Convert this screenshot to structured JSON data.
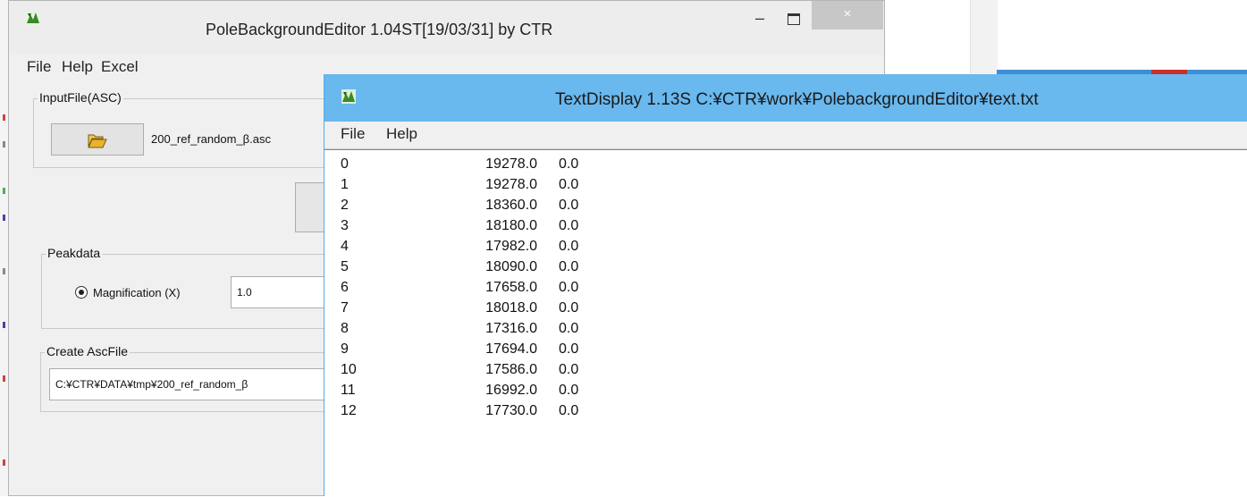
{
  "pole_editor": {
    "title": "PoleBackgroundEditor 1.04ST[19/03/31] by CTR",
    "window_controls": {
      "minimize": "–",
      "close": "×"
    },
    "menu": [
      "File",
      "Help",
      "Excel"
    ],
    "input_group": {
      "legend": "InputFile(ASC)",
      "open_icon": "folder-open-icon",
      "file_name": "200_ref_random_β.asc"
    },
    "peak_group": {
      "legend": "Peakdata",
      "radio_label": "Magnification (X)",
      "radio_selected": true,
      "magnification_value": "1.0"
    },
    "create_group": {
      "legend": "Create AscFile",
      "output_path": "C:¥CTR¥DATA¥tmp¥200_ref_random_β"
    }
  },
  "text_display": {
    "title": "TextDisplay 1.13S C:¥CTR¥work¥PolebackgroundEditor¥text.txt",
    "menu": [
      "File",
      "Help"
    ],
    "rows": [
      {
        "index": "0",
        "value": "19278.0",
        "extra": "0.0"
      },
      {
        "index": "1",
        "value": "19278.0",
        "extra": "0.0"
      },
      {
        "index": "2",
        "value": "18360.0",
        "extra": "0.0"
      },
      {
        "index": "3",
        "value": "18180.0",
        "extra": "0.0"
      },
      {
        "index": "4",
        "value": "17982.0",
        "extra": "0.0"
      },
      {
        "index": "5",
        "value": "18090.0",
        "extra": "0.0"
      },
      {
        "index": "6",
        "value": "17658.0",
        "extra": "0.0"
      },
      {
        "index": "7",
        "value": "18018.0",
        "extra": "0.0"
      },
      {
        "index": "8",
        "value": "17316.0",
        "extra": "0.0"
      },
      {
        "index": "9",
        "value": "17694.0",
        "extra": "0.0"
      },
      {
        "index": "10",
        "value": "17586.0",
        "extra": "0.0"
      },
      {
        "index": "11",
        "value": "16992.0",
        "extra": "0.0"
      },
      {
        "index": "12",
        "value": "17730.0",
        "extra": "0.0"
      }
    ]
  },
  "colors": {
    "text_display_titlebar": "#69b8ee",
    "editor_titlebar": "#ededed",
    "close_button": "#c7c7c7"
  }
}
